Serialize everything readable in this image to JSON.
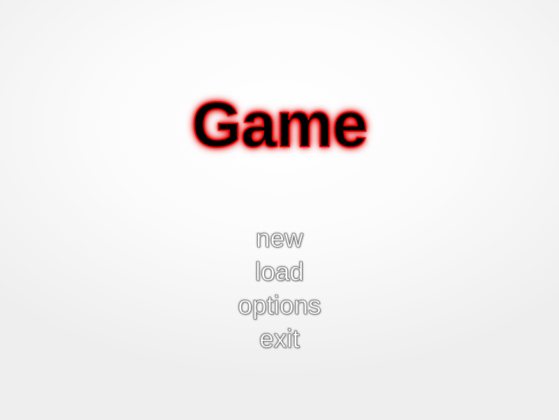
{
  "title": "Game",
  "menu": {
    "items": [
      {
        "label": "new"
      },
      {
        "label": "load"
      },
      {
        "label": "options"
      },
      {
        "label": "exit"
      }
    ]
  },
  "colors": {
    "title_fill": "#000000",
    "title_glow": "#e00000",
    "menu_text": "#ffffff",
    "menu_outline": "#707070",
    "background": "#f5f5f5"
  }
}
